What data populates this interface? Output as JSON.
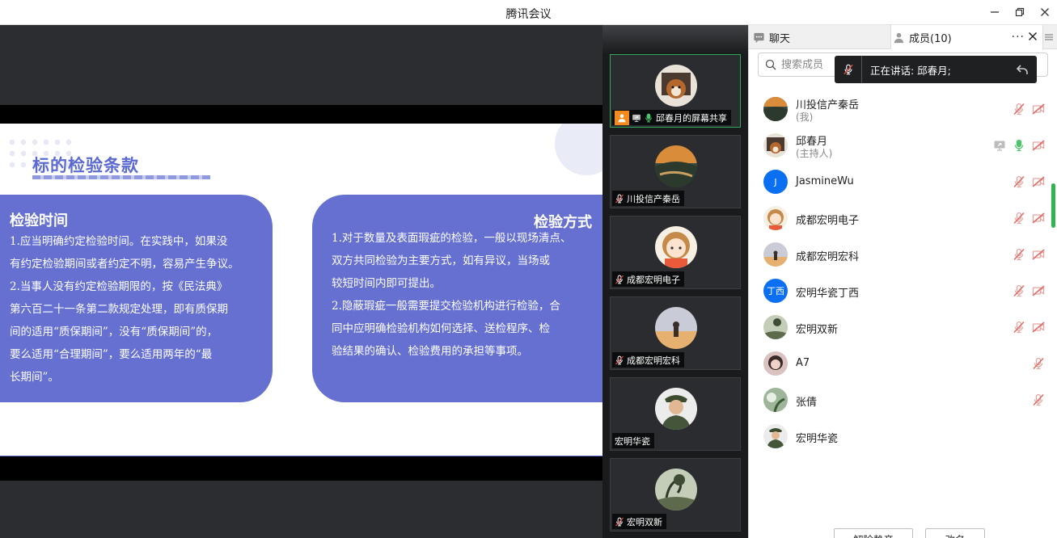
{
  "window": {
    "title": "腾讯会议"
  },
  "slide": {
    "title": "标的检验条款",
    "left_card": {
      "title": "检验时间",
      "lines": [
        "1.应当明确约定检验时间。在实践中，如果没",
        "有约定检验期间或者约定不明，容易产生争议。",
        "2.当事人没有约定检验期限的，按《民法典》",
        "第六百二十一条第二款规定处理，即有质保期",
        "间的适用“质保期间”，没有“质保期间”的，",
        "要么适用“合理期间”，要么适用两年的“最",
        "长期间”。"
      ]
    },
    "right_card": {
      "title": "检验方式",
      "lines": [
        "1.对于数量及表面瑕疵的检验，一般以现场清点、",
        "双方共同检验为主要方式，如有异议，当场或",
        "较短时间内即可提出。",
        "2.隐蔽瑕疵一般需要提交检验机构进行检验，合",
        "同中应明确检验机构如何选择、送检程序、检",
        "验结果的确认、检验费用的承担等事项。"
      ]
    }
  },
  "thumbnails": [
    {
      "name": "邱春月的屏幕共享",
      "avatar": "dog-photo",
      "active": true
    },
    {
      "name": "川投信产秦岳",
      "avatar": "landscape-sunset"
    },
    {
      "name": "成都宏明电子",
      "avatar": "cartoon-girl"
    },
    {
      "name": "成都宏明宏科",
      "avatar": "beach-person"
    },
    {
      "name": "宏明华瓷",
      "avatar": "uniform-man"
    },
    {
      "name": "宏明双新",
      "avatar": "tree-landscape"
    }
  ],
  "panel": {
    "tab_chat": "聊天",
    "tab_members": "成员(10)",
    "more": "···",
    "search_placeholder": "搜索成员",
    "speaking_label": "正在讲话: 邱春月;",
    "members": [
      {
        "name": "川投信产秦岳",
        "role": "(我)",
        "avatar": "landscape-sunset",
        "icons": [
          "mic-muted-icon",
          "camera-off-icon"
        ]
      },
      {
        "name": "邱春月",
        "role": "(主持人)",
        "avatar": "dog-photo",
        "icons": [
          "screen-share-icon",
          "mic-active-icon",
          "camera-off-icon"
        ]
      },
      {
        "name": "JasmineWu",
        "avatar_text": "J",
        "icons": [
          "mic-muted-icon",
          "camera-off-icon"
        ]
      },
      {
        "name": "成都宏明电子",
        "avatar": "cartoon-girl",
        "icons": [
          "mic-muted-icon",
          "camera-off-icon"
        ]
      },
      {
        "name": "成都宏明宏科",
        "avatar": "beach-person",
        "icons": [
          "mic-muted-icon",
          "camera-off-icon"
        ]
      },
      {
        "name": "宏明华瓷丁西",
        "avatar_text": "丁西",
        "icons": [
          "mic-muted-icon",
          "camera-off-icon"
        ]
      },
      {
        "name": "宏明双新",
        "avatar": "tree-landscape",
        "icons": [
          "mic-muted-icon",
          "camera-off-icon"
        ]
      },
      {
        "name": "A7",
        "avatar": "girl-photo",
        "icons": [
          "mic-muted-icon"
        ]
      },
      {
        "name": "张倩",
        "avatar": "plant-photo",
        "icons": [
          "mic-muted-icon"
        ]
      },
      {
        "name": "宏明华瓷",
        "avatar": "uniform-man",
        "icons": []
      }
    ],
    "unmute_all_button": "解除静音",
    "rename_button": "改名"
  },
  "colors": {
    "accent": "#6570d1",
    "active_green": "#2fa85a",
    "mute_red": "#e6807a",
    "avatar_blue": "#0b6ff2"
  }
}
